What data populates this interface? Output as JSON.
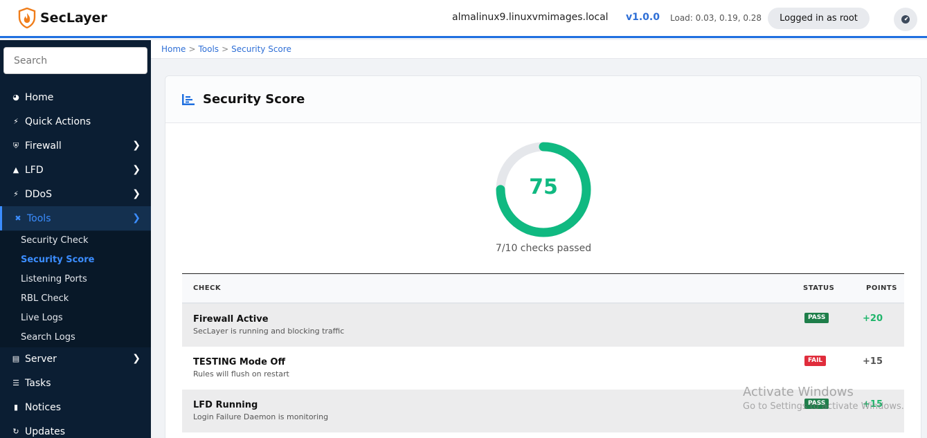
{
  "header": {
    "brand": "SecLayer",
    "hostname": "almalinux9.linuxvmimages.local",
    "version": "v1.0.0",
    "load": "Load: 0.03, 0.19, 0.28",
    "user_badge": "Logged in as root",
    "theme_icon": "gauge-icon"
  },
  "sidebar": {
    "search_placeholder": "Search",
    "items": [
      {
        "label": "Home",
        "icon": "dashboard-icon"
      },
      {
        "label": "Quick Actions",
        "icon": "bolt-icon"
      },
      {
        "label": "Firewall",
        "icon": "shield-icon"
      },
      {
        "label": "LFD",
        "icon": "warning-icon"
      },
      {
        "label": "DDoS",
        "icon": "bolt-icon"
      },
      {
        "label": "Tools",
        "icon": "tools-icon"
      },
      {
        "label": "Server",
        "icon": "server-icon"
      },
      {
        "label": "Tasks",
        "icon": "list-icon"
      },
      {
        "label": "Notices",
        "icon": "message-icon"
      },
      {
        "label": "Updates",
        "icon": "refresh-icon"
      }
    ],
    "tools_sub": [
      "Security Check",
      "Security Score",
      "Listening Ports",
      "RBL Check",
      "Live Logs",
      "Search Logs"
    ],
    "active_sub": "Security Score"
  },
  "breadcrumb": [
    "Home",
    "Tools",
    "Security Score"
  ],
  "card": {
    "title": "Security Score",
    "score": "75",
    "score_fraction": 0.75,
    "checks_passed": "7/10 checks passed",
    "table": {
      "headers": [
        "CHECK",
        "STATUS",
        "POINTS"
      ],
      "rows": [
        {
          "name": "Firewall Active",
          "desc": "SecLayer is running and blocking traffic",
          "status": "PASS",
          "points": "+20"
        },
        {
          "name": "TESTING Mode Off",
          "desc": "Rules will flush on restart",
          "status": "FAIL",
          "points": "+15"
        },
        {
          "name": "LFD Running",
          "desc": "Login Failure Daemon is monitoring",
          "status": "PASS",
          "points": "+15"
        }
      ]
    }
  },
  "watermark": {
    "line1": "Activate Windows",
    "line2": "Go to Settings to activate Windows."
  },
  "colors": {
    "accent": "#1f6fe0",
    "sidebar_bg": "#0b1e33",
    "score_green": "#10b981",
    "pass": "#1e7e4a",
    "fail": "#e02d3c"
  }
}
